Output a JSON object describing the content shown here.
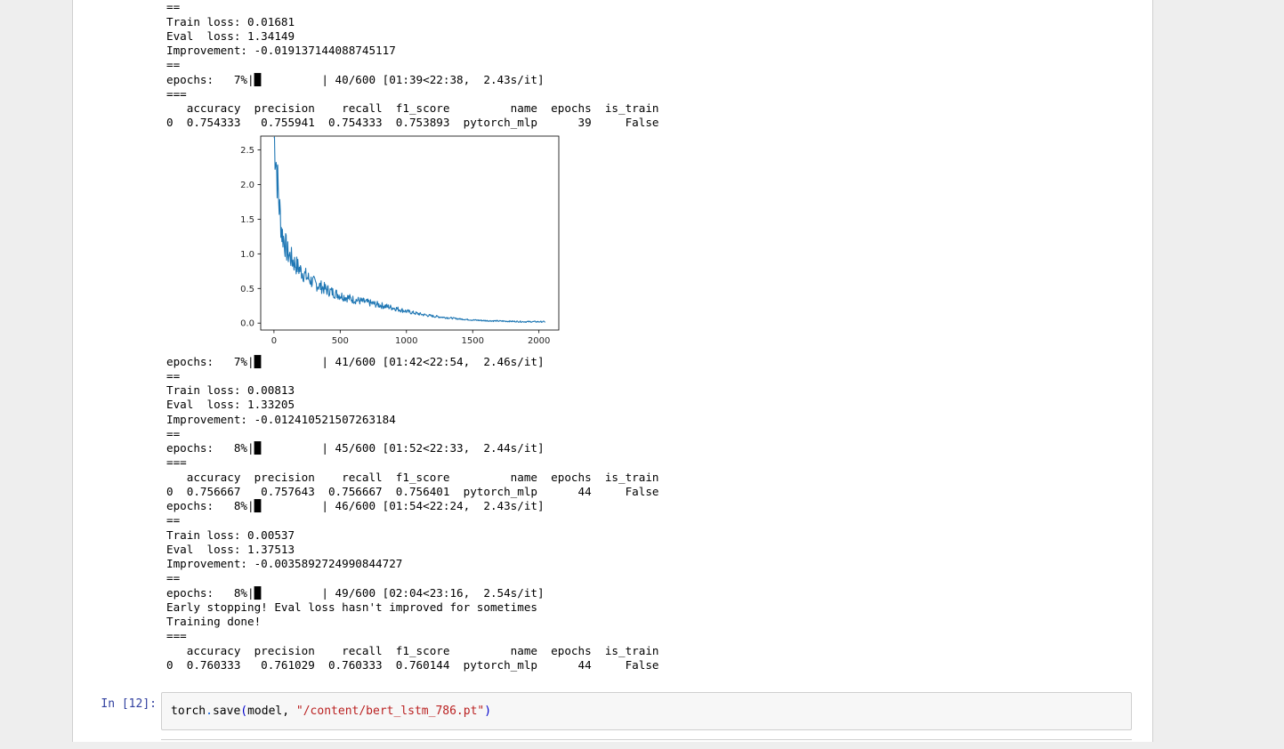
{
  "output_lines": [
    "==",
    "Train loss: 0.01681",
    "Eval  loss: 1.34149",
    "Improvement: -0.019137144088745117",
    "==",
    "epochs:   7%|█         | 40/600 [01:39<22:38,  2.43s/it]",
    "===",
    "   accuracy  precision    recall  f1_score         name  epochs  is_train",
    "0  0.754333   0.755941  0.754333  0.753893  pytorch_mlp      39     False",
    "epochs:   7%|█         | 41/600 [01:42<22:54,  2.46s/it]",
    "==",
    "Train loss: 0.00813",
    "Eval  loss: 1.33205",
    "Improvement: -0.012410521507263184",
    "==",
    "epochs:   8%|█         | 45/600 [01:52<22:33,  2.44s/it]",
    "===",
    "   accuracy  precision    recall  f1_score         name  epochs  is_train",
    "0  0.756667   0.757643  0.756667  0.756401  pytorch_mlp      44     False",
    "epochs:   8%|█         | 46/600 [01:54<22:24,  2.43s/it]",
    "==",
    "Train loss: 0.00537",
    "Eval  loss: 1.37513",
    "Improvement: -0.0035892724990844727",
    "==",
    "epochs:   8%|█         | 49/600 [02:04<23:16,  2.54s/it]",
    "Early stopping! Eval loss hasn't improved for sometimes",
    "Training done!",
    "===",
    "   accuracy  precision    recall  f1_score         name  epochs  is_train",
    "0  0.760333   0.761029  0.760333  0.760144  pytorch_mlp      44     False"
  ],
  "chart_data": {
    "type": "line",
    "title": "",
    "xlabel": "",
    "ylabel": "",
    "xlim": [
      -100,
      2150
    ],
    "ylim": [
      -0.1,
      2.7
    ],
    "xticks": [
      "0",
      "500",
      "1000",
      "1500",
      "2000"
    ],
    "yticks": [
      "0.0",
      "0.5",
      "1.0",
      "1.5",
      "2.0",
      "2.5"
    ],
    "grid": false,
    "line_color": "#1f77b4",
    "series": [
      {
        "x": [
          0,
          10,
          20,
          30,
          40,
          60,
          80,
          100,
          150,
          200,
          250,
          300,
          400,
          500,
          600,
          700,
          800,
          900,
          1000,
          1100,
          1200,
          1300,
          1400,
          1500,
          1600,
          1700,
          1800,
          1900,
          2000,
          2050
        ],
        "values": [
          2.68,
          2.55,
          2.25,
          1.95,
          1.7,
          1.3,
          1.18,
          1.02,
          0.88,
          0.76,
          0.66,
          0.58,
          0.48,
          0.4,
          0.34,
          0.3,
          0.26,
          0.22,
          0.17,
          0.13,
          0.1,
          0.08,
          0.06,
          0.045,
          0.035,
          0.03,
          0.025,
          0.02,
          0.02,
          0.02
        ]
      }
    ]
  },
  "input_cell": {
    "prompt": "In [12]:",
    "code": {
      "obj": "torch",
      "dot": ".",
      "fn": "save",
      "open": "(",
      "arg": "model, ",
      "str": "\"/content/bert_lstm_786.pt\"",
      "close": ")"
    }
  }
}
